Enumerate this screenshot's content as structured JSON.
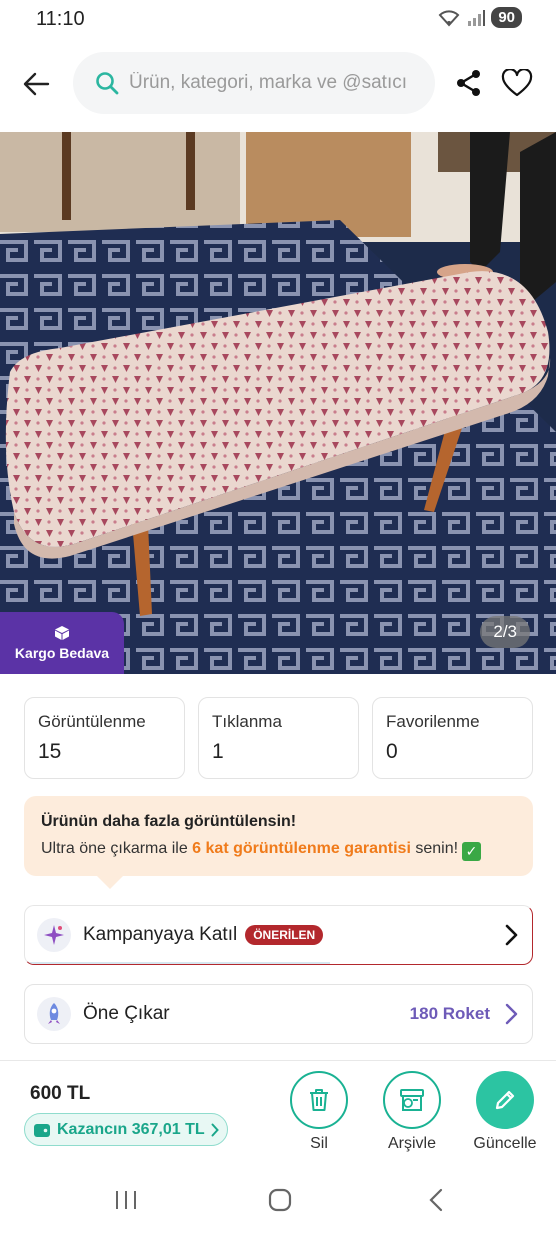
{
  "status_bar": {
    "time": "11:10",
    "battery": "90"
  },
  "search": {
    "placeholder": "Ürün, kategori, marka ve @satıcı"
  },
  "product": {
    "cargo_label": "Kargo Bedava",
    "image_counter": "2/3"
  },
  "stats": [
    {
      "label": "Görüntülenme",
      "value": "15"
    },
    {
      "label": "Tıklanma",
      "value": "1"
    },
    {
      "label": "Favorilenme",
      "value": "0"
    }
  ],
  "promo": {
    "title": "Ürünün daha fazla görüntülensin!",
    "text_before": "Ultra öne çıkarma ile ",
    "highlight": "6 kat görüntülenme garantisi",
    "text_after": " senin!"
  },
  "campaign": {
    "label": "Kampanyaya Katıl",
    "badge": "ÖNERİLEN"
  },
  "featured": {
    "label": "Öne Çıkar",
    "price": "180 Roket"
  },
  "bottom": {
    "price": "600 TL",
    "earnings": "Kazancın 367,01 TL",
    "delete_label": "Sil",
    "archive_label": "Arşivle",
    "update_label": "Güncelle"
  },
  "colors": {
    "accent": "#2cc4a2",
    "cargo_badge": "#5b33a6",
    "recommended": "#b3282d",
    "promo_bg": "#fdecdc",
    "highlight": "#f07b1b",
    "roket": "#6e5bb8"
  },
  "icons": {
    "back": "arrow-left-icon",
    "search": "search-icon",
    "share": "share-icon",
    "favorite": "heart-icon",
    "cargo": "package-icon",
    "campaign": "sparkle-icon",
    "featured": "rocket-icon",
    "delete": "trash-icon",
    "archive": "archive-icon",
    "update": "pencil-icon"
  }
}
